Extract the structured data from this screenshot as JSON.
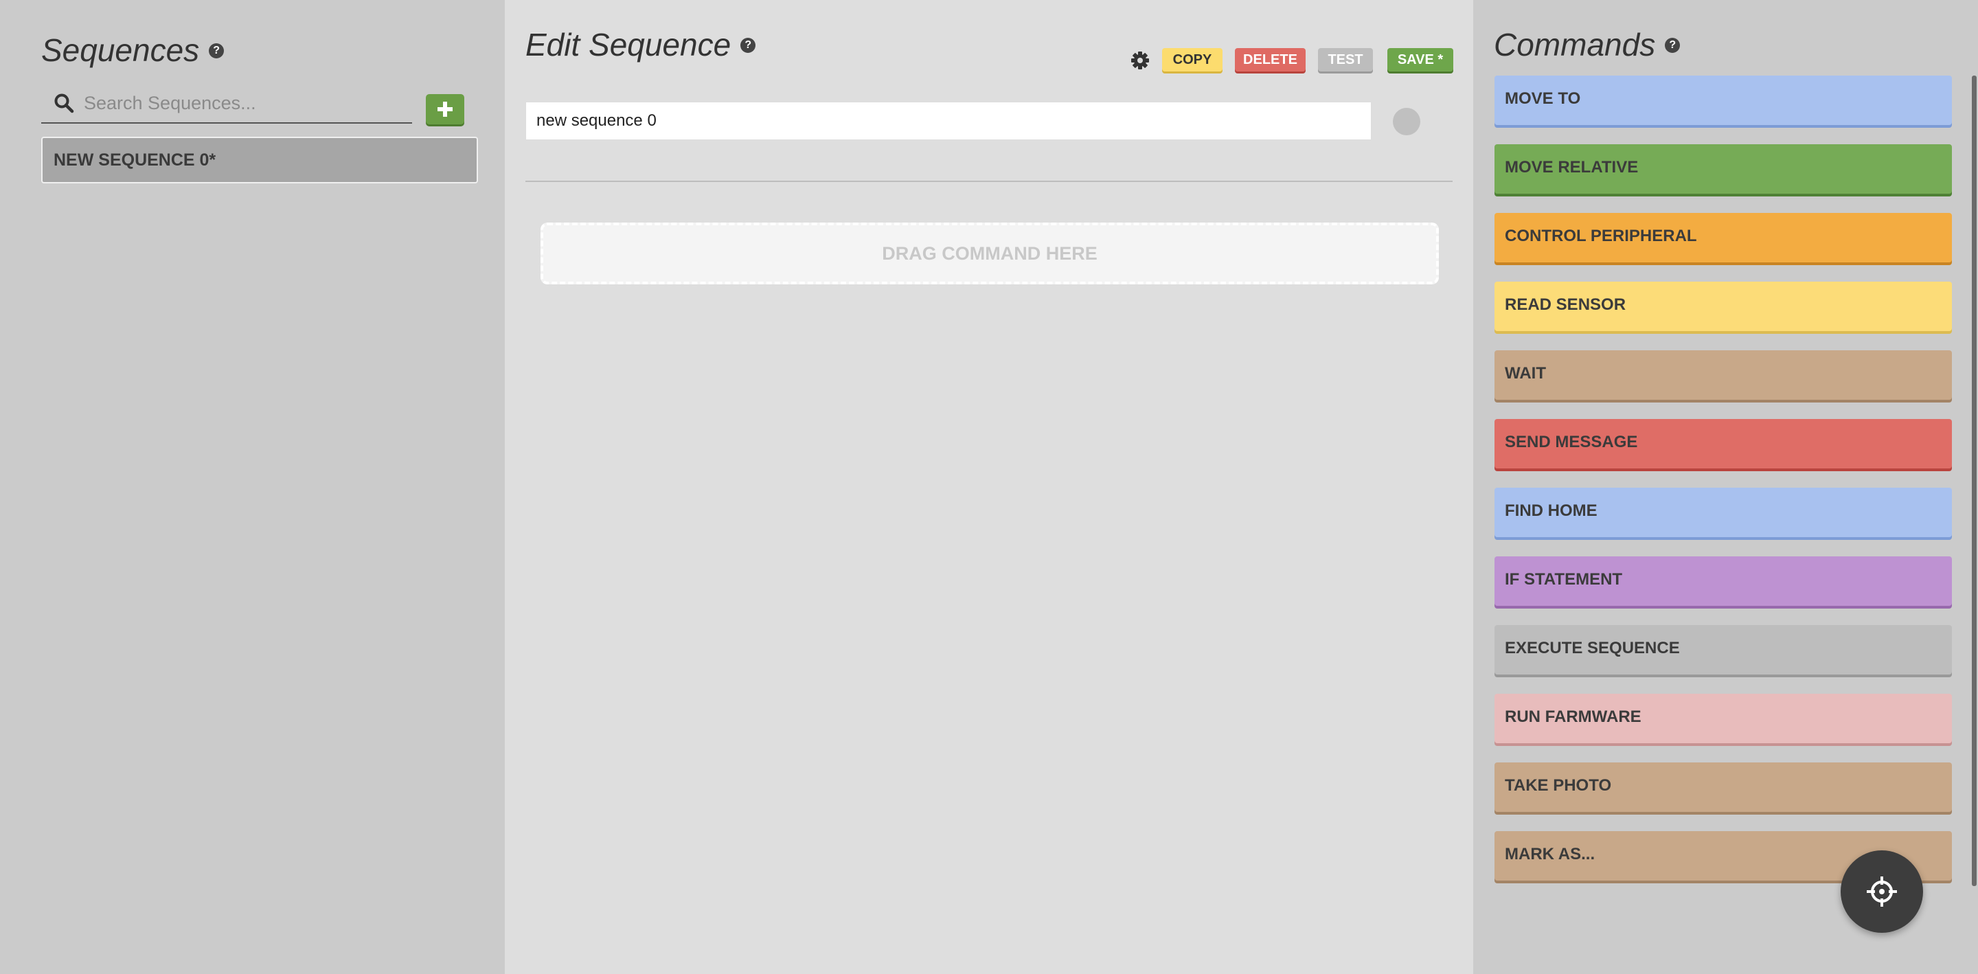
{
  "sequences_panel": {
    "title": "Sequences",
    "help_icon": "help-circle-icon",
    "search": {
      "placeholder": "Search Sequences...",
      "value": ""
    },
    "add_icon": "plus-icon",
    "items": [
      {
        "label": "NEW SEQUENCE 0*"
      }
    ]
  },
  "editor": {
    "title": "Edit Sequence",
    "help_icon": "help-circle-icon",
    "settings_icon": "gear-icon",
    "buttons": {
      "copy": "COPY",
      "delete": "DELETE",
      "test": "TEST",
      "save": "SAVE *"
    },
    "name_value": "new sequence 0",
    "color_dot_color": "#c0c0c0",
    "dropzone_label": "DRAG COMMAND HERE"
  },
  "commands_panel": {
    "title": "Commands",
    "help_icon": "help-circle-icon",
    "commands": [
      {
        "label": "MOVE TO",
        "color": "#a8c1ef",
        "shadow": "#7d9cd6"
      },
      {
        "label": "MOVE RELATIVE",
        "color": "#76ab56",
        "shadow": "#4f8136"
      },
      {
        "label": "CONTROL PERIPHERAL",
        "color": "#f3ac41",
        "shadow": "#c88423"
      },
      {
        "label": "READ SENSOR",
        "color": "#fcdc78",
        "shadow": "#dcbb51"
      },
      {
        "label": "WAIT",
        "color": "#c8a889",
        "shadow": "#a38466"
      },
      {
        "label": "SEND MESSAGE",
        "color": "#df6d66",
        "shadow": "#b9443e"
      },
      {
        "label": "FIND HOME",
        "color": "#a8c1ef",
        "shadow": "#7d9cd6"
      },
      {
        "label": "IF STATEMENT",
        "color": "#be92d2",
        "shadow": "#9869ad"
      },
      {
        "label": "EXECUTE SEQUENCE",
        "color": "#bdbdbd",
        "shadow": "#999999"
      },
      {
        "label": "RUN FARMWARE",
        "color": "#e8bcbc",
        "shadow": "#c79292"
      },
      {
        "label": "TAKE PHOTO",
        "color": "#c8a889",
        "shadow": "#a38466"
      },
      {
        "label": "MARK AS...",
        "color": "#c8a889",
        "shadow": "#a38466"
      }
    ]
  },
  "fab_icon": "crosshair-icon"
}
